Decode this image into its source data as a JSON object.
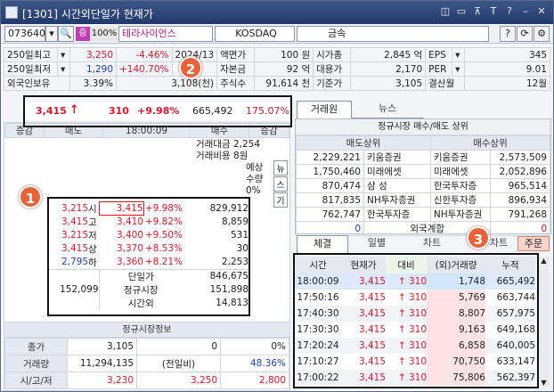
{
  "window": {
    "title": "[1301] 시간외단일가 현재가",
    "buttons": [
      "◫",
      "▭",
      "⊼",
      "T",
      "?",
      "–",
      "✕"
    ]
  },
  "toolbar": {
    "code": "073640",
    "ratio": "100%",
    "name_prefix": "증",
    "stock_name": "테라사이언스",
    "market": "KOSDAQ",
    "sector": "금속"
  },
  "info": {
    "r1": {
      "label": "250일최고",
      "price": "3,250",
      "pct": "-4.46%",
      "date": "2024/13",
      "k1": "액면가",
      "v1": "100 원",
      "k2": "시가총",
      "v2": "2,845 억",
      "k3": "EPS",
      "v3": "345"
    },
    "r2": {
      "label": "250일최저",
      "price": "1,290",
      "pct": "+140.70%",
      "date": "",
      "k1": "자본금",
      "v1": "92 억",
      "k2": "대용가",
      "v2": "2,170",
      "k3": "PER",
      "v3": "9.01"
    },
    "r3": {
      "label": "외국인보유",
      "price": "3.39%",
      "pct": "3,108(천)",
      "k1": "주식수",
      "v1": "91,614 천",
      "k2": "기준가",
      "v2": "3,105",
      "k3": "결산월",
      "v3": "12월"
    }
  },
  "summary": {
    "price": "3,415",
    "arrow": "↑",
    "change": "310",
    "pct": "+9.98%",
    "volume": "665,492",
    "vol_pct": "175.07%"
  },
  "tabs_top": {
    "t1": "거래원",
    "t2": "뉴스"
  },
  "order": {
    "headers": [
      "증감",
      "매도",
      "18:00:09",
      "매수",
      "증감"
    ],
    "side_labels": {
      "amount": "거래대금",
      "amount_v": "2,254",
      "cost": "거래비용",
      "cost_v": "8원",
      "expected": "예상",
      "qty": "수량",
      "pct0": "0%"
    },
    "side_btns": [
      "뉴",
      "스",
      "기"
    ],
    "rows": [
      {
        "price": "3,215",
        "tag": "시",
        "cur": "3,415",
        "pct": "+9.98%",
        "qty": "829,912"
      },
      {
        "price": "3,415",
        "tag": "고",
        "cur": "3,410",
        "pct": "+9.82%",
        "qty": "8,859"
      },
      {
        "price": "3,215",
        "tag": "저",
        "cur": "3,400",
        "pct": "+9.50%",
        "qty": "531"
      },
      {
        "price": "3,415",
        "tag": "상",
        "cur": "3,370",
        "pct": "+8.53%",
        "qty": "30"
      },
      {
        "price": "2,795",
        "tag": "하",
        "cur": "3,360",
        "pct": "+8.21%",
        "qty": "2,253"
      }
    ],
    "bottom": {
      "single": "단일가",
      "single_v": "846,675",
      "regular": "정규시장",
      "regular_v": "151,898",
      "left_v": "152,099",
      "after": "시간외",
      "after_v": "14,813"
    }
  },
  "regular_info": {
    "title": "정규시장정보",
    "rows": [
      {
        "label": "종가",
        "v1": "3,105",
        "v2": "0",
        "v3": "0%"
      },
      {
        "label": "거래량",
        "v1": "11,294,135",
        "v2": "(전일비)",
        "v3": "48.36%"
      },
      {
        "label": "시/고/저",
        "v1": "3,230",
        "v2": "3,250",
        "v3": "2,800"
      }
    ]
  },
  "broker": {
    "title": "정규시장 매수/매도 상위",
    "sell_h": "매도상위",
    "buy_h": "매수상위",
    "rows": [
      {
        "sq": "2,229,221",
        "sn": "키움증권",
        "bn": "키움증권",
        "bq": "2,573,509"
      },
      {
        "sq": "1,750,460",
        "sn": "미래에셋",
        "bn": "미래에셋",
        "bq": "2,052,896"
      },
      {
        "sq": "870,474",
        "sn": "삼  성",
        "bn": "한국투자증",
        "bq": "965,514"
      },
      {
        "sq": "817,835",
        "sn": "NH투자증권",
        "bn": "신한투자증",
        "bq": "896,934"
      },
      {
        "sq": "762,747",
        "sn": "한국투자증",
        "bn": "NH투자증권",
        "bq": "791,268"
      }
    ],
    "foreign": {
      "l": "0",
      "label": "외국계합",
      "r": "0"
    }
  },
  "tabs_bottom": {
    "t1": "체결",
    "t2": "일별",
    "t3": "차트",
    "t4": "차트",
    "t5": "주문"
  },
  "trades": {
    "headers": [
      "시간",
      "현재가",
      "대비",
      "(외)거래량",
      "누적"
    ],
    "rows": [
      {
        "time": "18:00:09",
        "price": "3,415",
        "chg": "310",
        "vol": "1,748",
        "cum": "665,492"
      },
      {
        "time": "17:50:16",
        "price": "3,415",
        "chg": "310",
        "vol": "5,769",
        "cum": "663,744"
      },
      {
        "time": "17:40:30",
        "price": "3,415",
        "chg": "310",
        "vol": "8,807",
        "cum": "657,975"
      },
      {
        "time": "17:30:30",
        "price": "3,415",
        "chg": "310",
        "vol": "9,163",
        "cum": "649,168"
      },
      {
        "time": "17:20:24",
        "price": "3,415",
        "chg": "310",
        "vol": "6,858",
        "cum": "640,005"
      },
      {
        "time": "17:10:27",
        "price": "3,415",
        "chg": "310",
        "vol": "70,750",
        "cum": "633,147"
      },
      {
        "time": "17:00:22",
        "price": "3,415",
        "chg": "310",
        "vol": "75,806",
        "cum": "562,397"
      }
    ]
  },
  "annotations": {
    "a1": "1",
    "a2": "2",
    "a3": "3"
  }
}
